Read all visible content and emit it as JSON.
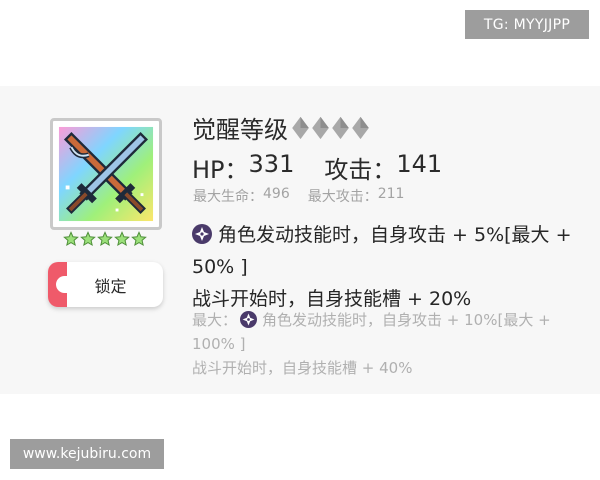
{
  "watermarks": {
    "telegram": "TG: MYYJJPP",
    "website": "www.kejubiru.com"
  },
  "item": {
    "icon": "crossed-swords-icon",
    "star_count": 5,
    "star_color": "#9be07a",
    "lock_button_label": "锁定",
    "lock_accent_color": "#ef5a6a"
  },
  "awakening": {
    "label": "觉醒等级",
    "level_diamonds": 4,
    "diamond_color": "#a8a8a8"
  },
  "stats": {
    "hp_label": "HP：",
    "hp_value": "331",
    "atk_label": "攻击：",
    "atk_value": "141",
    "max_hp_label": "最大生命：",
    "max_hp_value": "496",
    "max_atk_label": "最大攻击：",
    "max_atk_value": "211"
  },
  "skills": {
    "skill_icon": "shuriken-icon",
    "skill_icon_color": "#4a3a6a",
    "line1": "角色发动技能时，自身攻击 + 5%[最大 + 50% ]",
    "line2": "战斗开始时，自身技能槽 + 20%",
    "max_prefix": "最大：",
    "max_line1": "角色发动技能时，自身攻击 + 10%[最大 + 100% ]",
    "max_line2": "战斗开始时，自身技能槽 + 40%"
  }
}
